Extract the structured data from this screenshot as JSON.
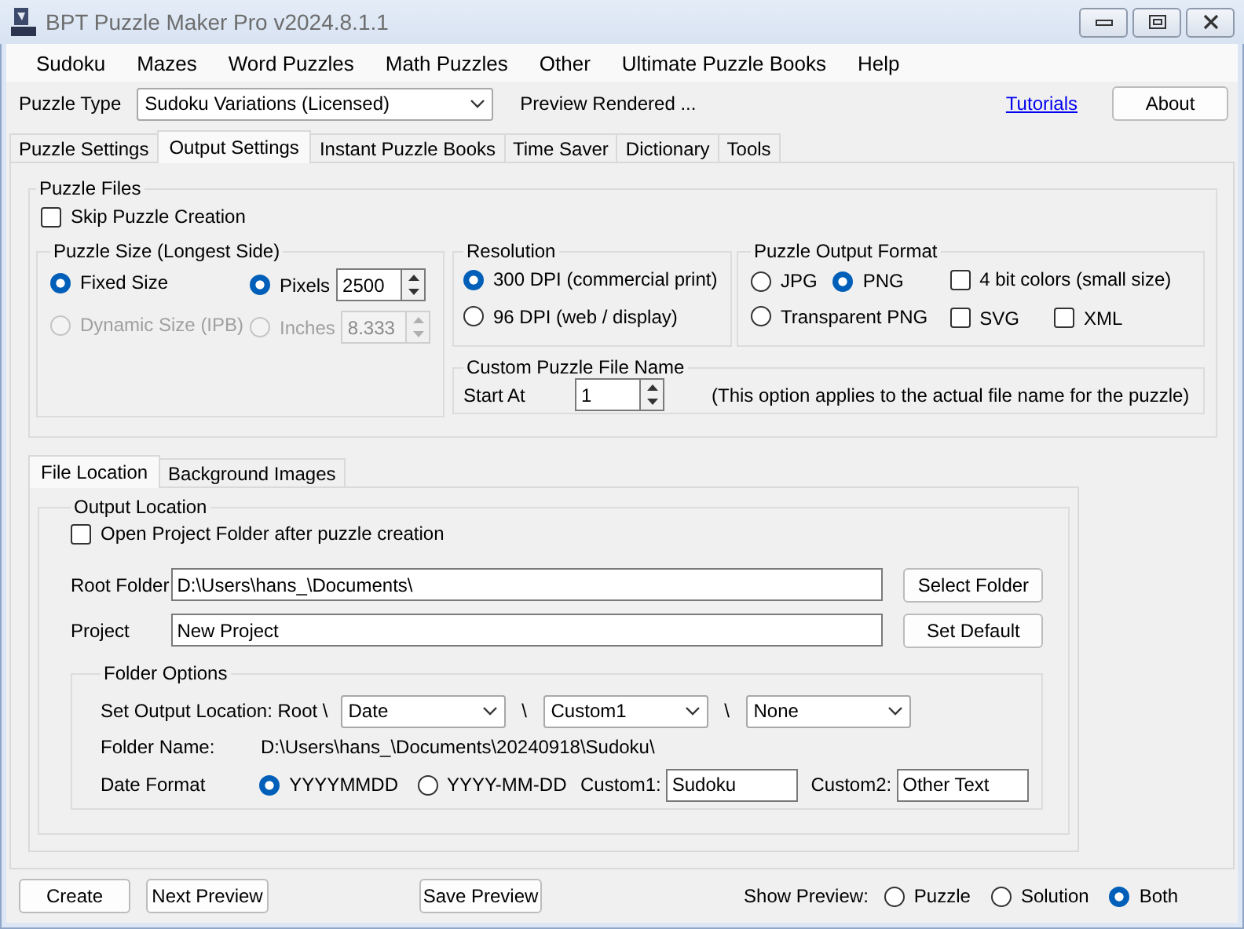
{
  "window": {
    "title": "BPT Puzzle Maker Pro v2024.8.1.1"
  },
  "menu": [
    "Sudoku",
    "Mazes",
    "Word Puzzles",
    "Math Puzzles",
    "Other",
    "Ultimate Puzzle Books",
    "Help"
  ],
  "toolbar": {
    "puzzle_type_label": "Puzzle Type",
    "puzzle_type": "Sudoku Variations (Licensed)",
    "status": "Preview Rendered ...",
    "tutorials_link": "Tutorials",
    "about_button": "About"
  },
  "tabs": [
    {
      "label": "Puzzle Settings",
      "selected": false
    },
    {
      "label": "Output Settings",
      "selected": true
    },
    {
      "label": "Instant Puzzle Books",
      "selected": false
    },
    {
      "label": "Time Saver",
      "selected": false
    },
    {
      "label": "Dictionary",
      "selected": false
    },
    {
      "label": "Tools",
      "selected": false
    }
  ],
  "puzzle_files": {
    "title": "Puzzle Files",
    "skip": {
      "label": "Skip Puzzle Creation",
      "checked": false
    },
    "size": {
      "title": "Puzzle Size (Longest Side)",
      "modes": [
        {
          "label": "Fixed Size",
          "selected": true,
          "disabled": false
        },
        {
          "label": "Dynamic Size (IPB)",
          "selected": false,
          "disabled": true
        }
      ],
      "units": [
        {
          "label": "Pixels",
          "selected": true,
          "value": "2500",
          "disabled": false
        },
        {
          "label": "Inches",
          "selected": false,
          "value": "8.333",
          "disabled": true
        }
      ]
    },
    "resolution": {
      "title": "Resolution",
      "options": [
        {
          "label": "300 DPI (commercial print)",
          "selected": true
        },
        {
          "label": "96  DPI (web / display)",
          "selected": false
        }
      ]
    },
    "format": {
      "title": "Puzzle Output Format",
      "formats": [
        {
          "label": "JPG",
          "selected": false
        },
        {
          "label": "PNG",
          "selected": true
        },
        {
          "label": "Transparent PNG",
          "selected": false
        }
      ],
      "checks": [
        {
          "label": "4 bit colors (small size)",
          "checked": false
        },
        {
          "label": "SVG",
          "checked": false
        },
        {
          "label": "XML",
          "checked": false
        }
      ]
    },
    "file_name": {
      "title": "Custom Puzzle File Name",
      "start_label": "Start At",
      "start_value": "1",
      "note": "(This option applies to the actual file name for the puzzle)"
    }
  },
  "sub_tabs": [
    {
      "label": "File Location",
      "selected": true
    },
    {
      "label": "Background Images",
      "selected": false
    }
  ],
  "output_location": {
    "title": "Output Location",
    "open_folder": {
      "label": "Open Project Folder after puzzle creation",
      "checked": false
    },
    "root_folder": {
      "label": "Root Folder",
      "value": "D:\\Users\\hans_\\Documents\\",
      "button": "Select Folder"
    },
    "project": {
      "label": "Project",
      "value": "New Project",
      "button": "Set Default"
    },
    "folder_options": {
      "title": "Folder Options",
      "set_label": "Set Output Location: Root \\",
      "levels": [
        "Date",
        "Custom1",
        "None"
      ],
      "separators": [
        "\\",
        "\\"
      ],
      "folder_name_label": "Folder Name:",
      "folder_name": "D:\\Users\\hans_\\Documents\\20240918\\Sudoku\\",
      "date_format_label": "Date Format",
      "date_formats": [
        {
          "label": "YYYYMMDD",
          "selected": true
        },
        {
          "label": "YYYY-MM-DD",
          "selected": false
        }
      ],
      "custom_fields": [
        {
          "label": "Custom1:",
          "value": "Sudoku"
        },
        {
          "label": "Custom2:",
          "value": "Other Text"
        }
      ]
    }
  },
  "footer": {
    "buttons": [
      "Create",
      "Next Preview",
      "Save Preview"
    ],
    "show_label": "Show Preview:",
    "preview_options": [
      {
        "label": "Puzzle",
        "selected": false
      },
      {
        "label": "Solution",
        "selected": false
      },
      {
        "label": "Both",
        "selected": true
      }
    ]
  }
}
